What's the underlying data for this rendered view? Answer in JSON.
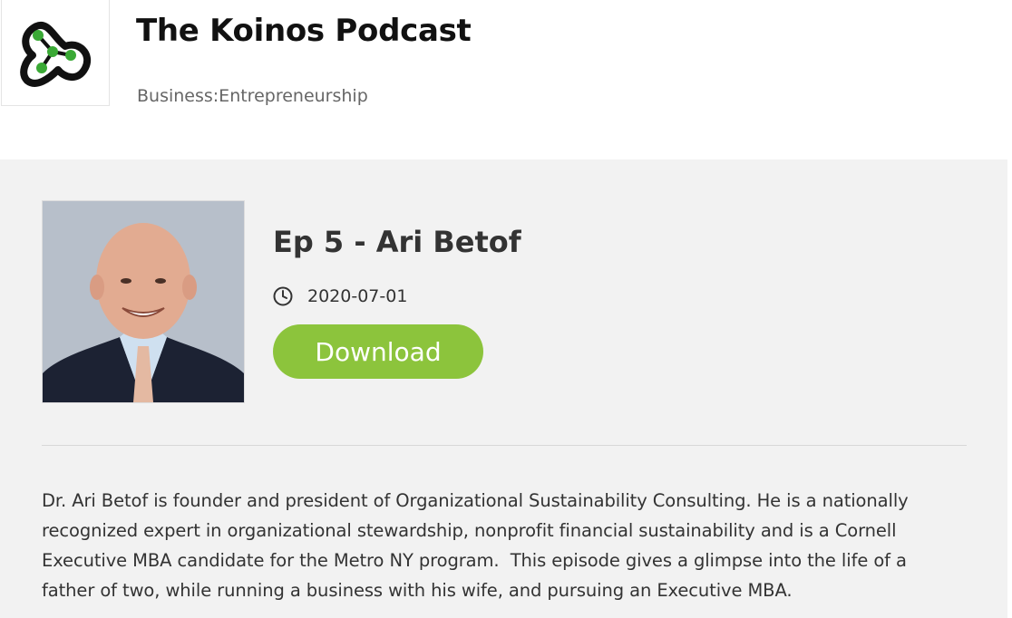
{
  "podcast": {
    "title": "The Koinos Podcast",
    "category": "Business:Entrepreneurship",
    "logo_icon": "koinos-logo-icon"
  },
  "episode": {
    "title": "Ep 5 - Ari Betof",
    "date": "2020-07-01",
    "date_icon": "clock-icon",
    "download_label": "Download",
    "image": "host-photo",
    "description": "Dr. Ari Betof is founder and president of Organizational Sustainability Consulting. He is a nationally recognized expert in organizational stewardship, nonprofit financial sustainability and is a Cornell Executive MBA candidate for the Metro NY program.  This episode gives a glimpse into the life of a father of two, while running a business with his wife, and pursuing an Executive MBA."
  },
  "colors": {
    "accent": "#8cc43c",
    "panel_background": "#f2f2f2",
    "logo_green": "#3aa935"
  }
}
